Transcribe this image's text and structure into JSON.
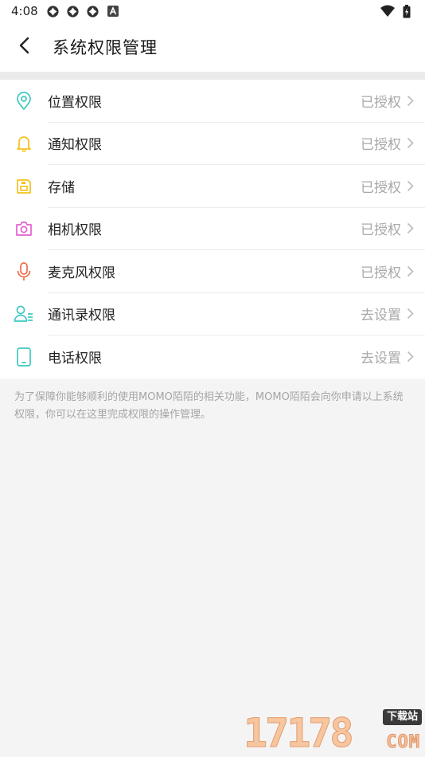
{
  "status_bar": {
    "time": "4:08",
    "left_icons": [
      "gear-icon",
      "gear-icon",
      "gear-icon",
      "a-badge-icon"
    ],
    "right_icons": [
      "wifi-icon",
      "battery-icon"
    ]
  },
  "header": {
    "title": "系统权限管理",
    "back_icon": "chevron-left-icon"
  },
  "permissions": [
    {
      "label": "位置权限",
      "status": "已授权",
      "icon": "location-icon",
      "color": "#3fc9c0"
    },
    {
      "label": "通知权限",
      "status": "已授权",
      "icon": "bell-icon",
      "color": "#f3c21a"
    },
    {
      "label": "存储",
      "status": "已授权",
      "icon": "storage-icon",
      "color": "#f3c21a"
    },
    {
      "label": "相机权限",
      "status": "已授权",
      "icon": "camera-icon",
      "color": "#e45fce"
    },
    {
      "label": "麦克风权限",
      "status": "已授权",
      "icon": "microphone-icon",
      "color": "#f06a4a"
    },
    {
      "label": "通讯录权限",
      "status": "去设置",
      "icon": "contacts-icon",
      "color": "#3fc9c0"
    },
    {
      "label": "电话权限",
      "status": "去设置",
      "icon": "phone-icon",
      "color": "#3fc9c0"
    }
  ],
  "footer_note": "为了保障你能够顺利的使用MOMO陌陌的相关功能，MOMO陌陌会向你申请以上系统权限，你可以在这里完成权限的操作管理。",
  "watermark": {
    "digits": "17178",
    "tag": "下载站",
    "suffix": "COM"
  }
}
